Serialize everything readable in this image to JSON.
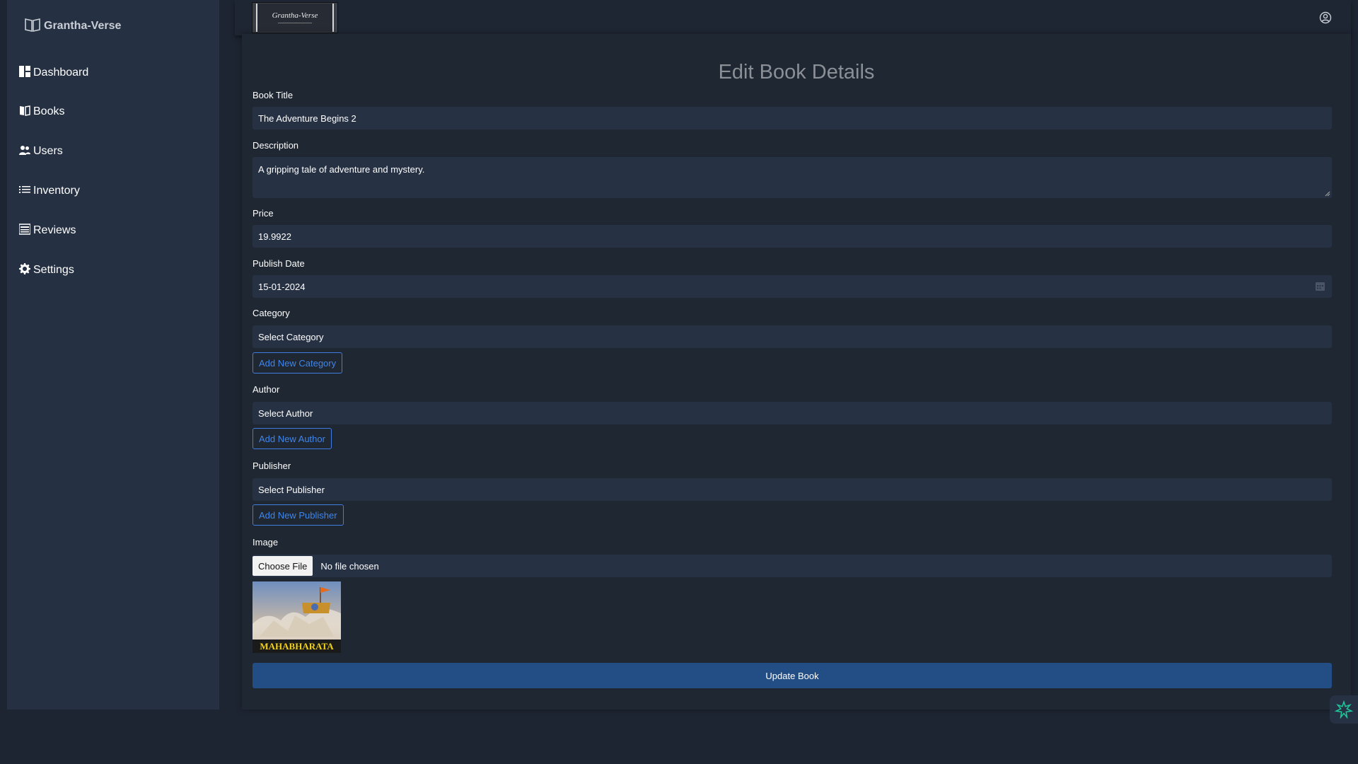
{
  "sidebar": {
    "brand": "Grantha-Verse",
    "items": [
      {
        "label": "Dashboard",
        "icon": "dashboard-icon"
      },
      {
        "label": "Books",
        "icon": "book-icon"
      },
      {
        "label": "Users",
        "icon": "users-icon"
      },
      {
        "label": "Inventory",
        "icon": "list-icon"
      },
      {
        "label": "Reviews",
        "icon": "reviews-icon"
      },
      {
        "label": "Settings",
        "icon": "gear-icon"
      }
    ]
  },
  "header": {
    "logo_title": "Grantha-Verse",
    "user_icon": "user-circle-icon"
  },
  "form": {
    "title": "Edit Book Details",
    "book_title_label": "Book Title",
    "book_title_value": "The Adventure Begins 2",
    "description_label": "Description",
    "description_value": "A gripping tale of adventure and mystery.",
    "price_label": "Price",
    "price_value": "19.9922",
    "publish_date_label": "Publish Date",
    "publish_date_value": "15-01-2024",
    "category_label": "Category",
    "category_value": "Select Category",
    "add_category_label": "Add New Category",
    "author_label": "Author",
    "author_value": "Select Author",
    "add_author_label": "Add New Author",
    "publisher_label": "Publisher",
    "publisher_value": "Select Publisher",
    "add_publisher_label": "Add New Publisher",
    "image_label": "Image",
    "choose_file_label": "Choose File",
    "file_status": "No file chosen",
    "cover_text": "MAHABHARATA",
    "submit_label": "Update Book"
  },
  "colors": {
    "background": "#1e2532",
    "sidebar": "#253042",
    "field": "#263144",
    "accent": "#3f86ea",
    "primary_button": "#234d85"
  }
}
